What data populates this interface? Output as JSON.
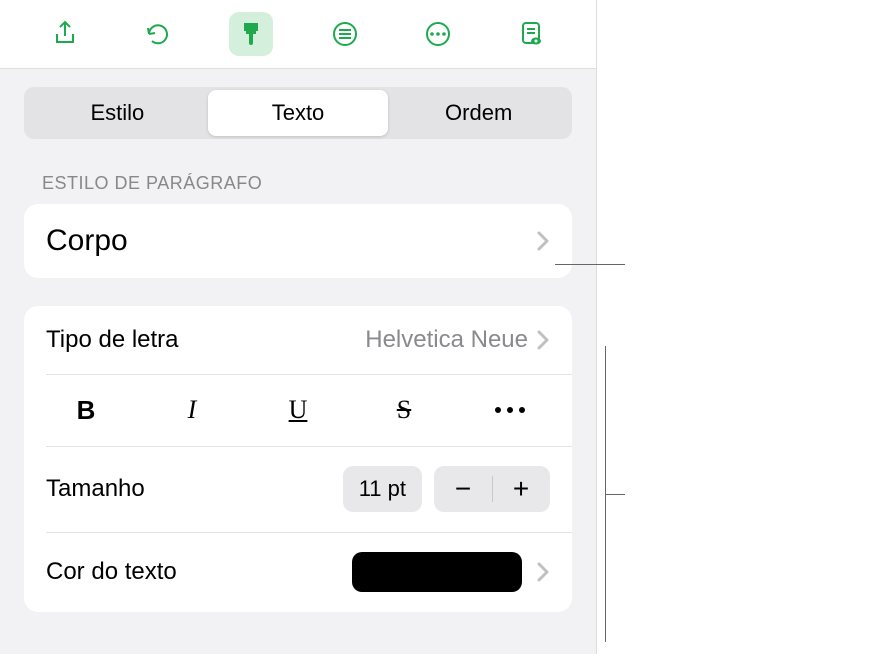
{
  "toolbar": {
    "icons": [
      "share",
      "undo",
      "brush",
      "list",
      "more",
      "doc-eye"
    ]
  },
  "tabs": {
    "items": [
      {
        "label": "Estilo",
        "active": false
      },
      {
        "label": "Texto",
        "active": true
      },
      {
        "label": "Ordem",
        "active": false
      }
    ]
  },
  "paragraph_style": {
    "header": "ESTILO DE PARÁGRAFO",
    "value": "Corpo"
  },
  "font": {
    "label": "Tipo de letra",
    "value": "Helvetica Neue"
  },
  "styles": {
    "bold": "B",
    "italic": "I",
    "underline": "U",
    "strike": "S"
  },
  "size": {
    "label": "Tamanho",
    "value": "11 pt"
  },
  "color": {
    "label": "Cor do texto",
    "value": "#000000"
  }
}
